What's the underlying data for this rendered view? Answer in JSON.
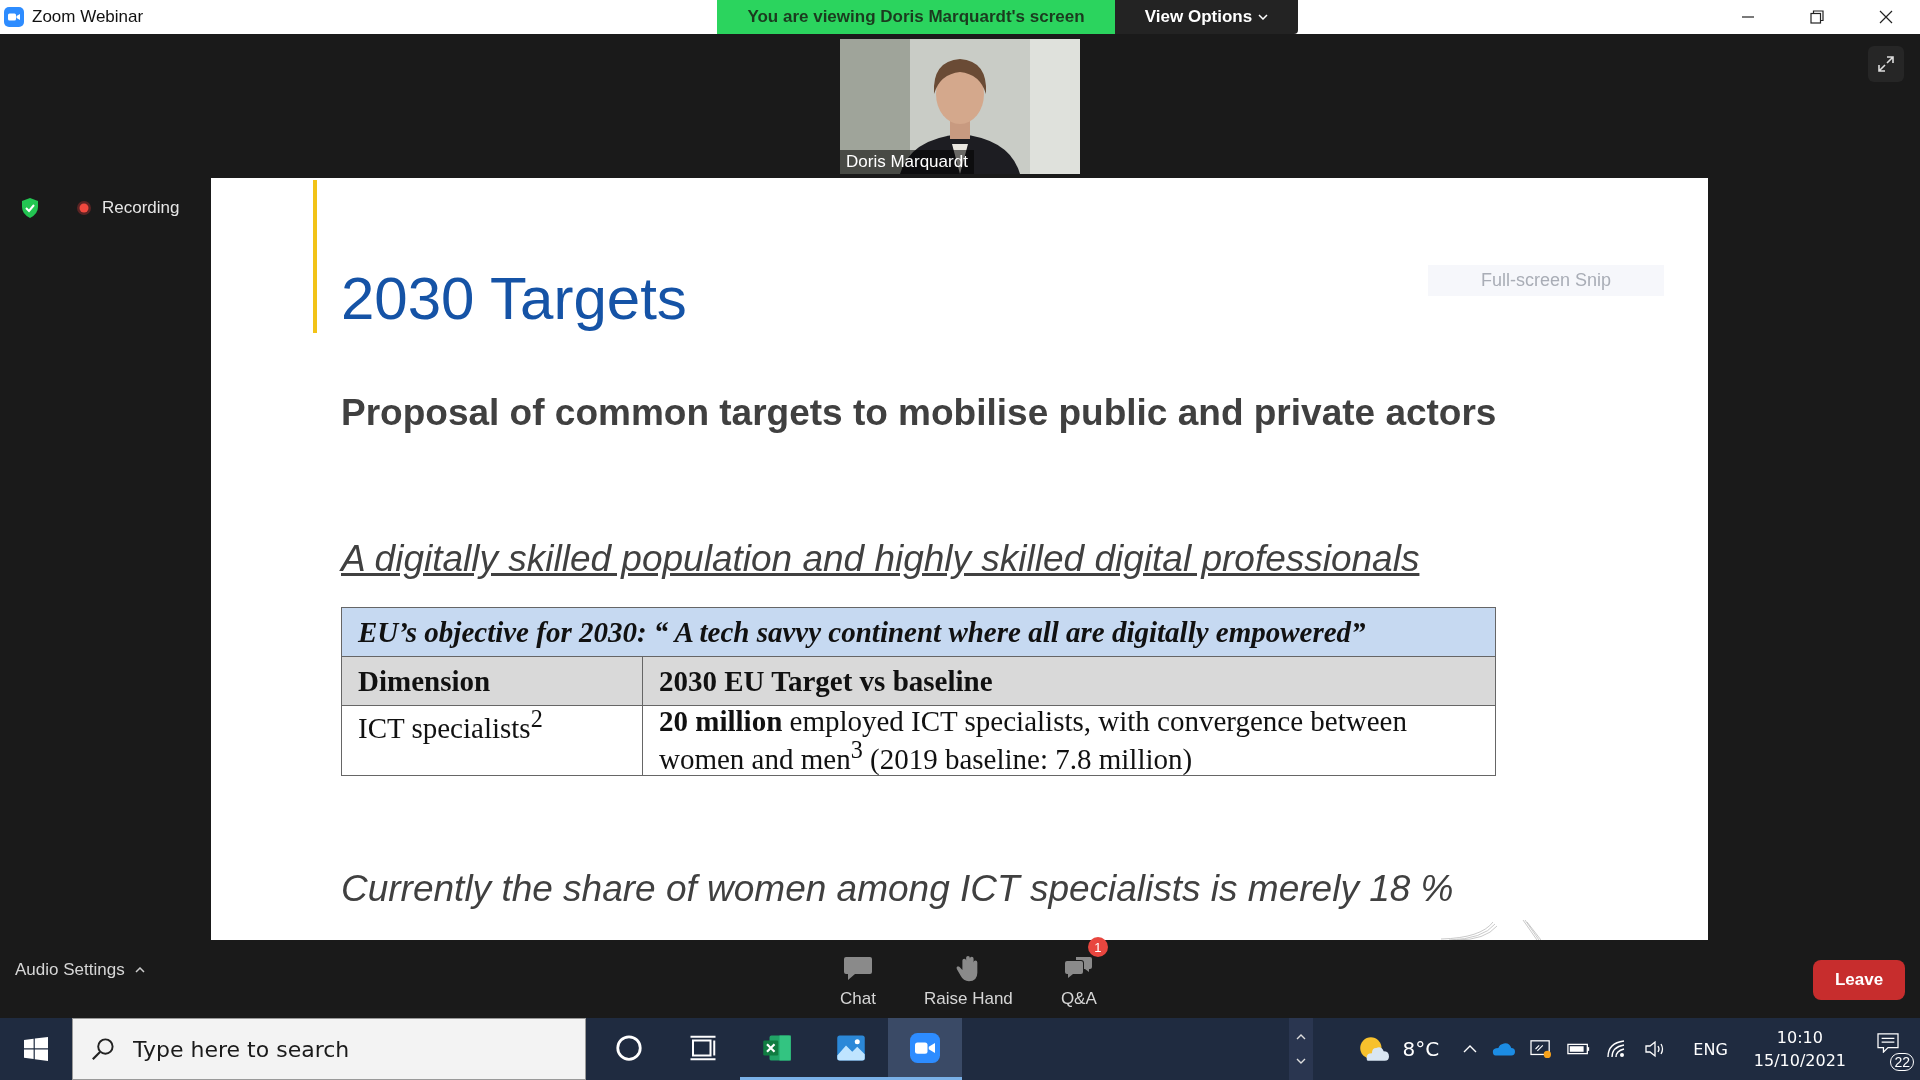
{
  "window": {
    "title": "Zoom Webinar"
  },
  "share_banner": {
    "text": "You are viewing Doris Marquardt's screen",
    "view_options": "View Options"
  },
  "video": {
    "name": "Doris Marquardt"
  },
  "recording": {
    "label": "Recording"
  },
  "slide": {
    "title": "2030 Targets",
    "subtitle": "Proposal of common targets to mobilise public and private actors",
    "section_heading": "A digitally skilled population and highly skilled digital professionals",
    "table": {
      "caption": "EU’s objective for 2030: “ A tech savvy continent where all are digitally empowered”",
      "columns": [
        "Dimension",
        "2030 EU Target vs baseline"
      ],
      "rows": [
        [
          "ICT specialists$^{2}$",
          "**20 million** employed ICT specialists, with convergence between women and men$^{3}$ (2019 baseline: 7.8 million)"
        ]
      ]
    },
    "footer": "Currently the share of women among ICT specialists is merely 18 %"
  },
  "snip_tooltip": "Full-screen Snip",
  "audio_settings": "Audio Settings",
  "toolbar": [
    {
      "kind": "chat",
      "label": "Chat"
    },
    {
      "kind": "hand",
      "label": "Raise Hand"
    },
    {
      "kind": "qa",
      "label": "Q&A",
      "badge": "1"
    }
  ],
  "leave": "Leave",
  "taskbar": {
    "search": {
      "placeholder": "Type here to search"
    },
    "apps": [
      {
        "kind": "cortana",
        "running": false,
        "selected": false
      },
      {
        "kind": "taskview",
        "running": false,
        "selected": false
      },
      {
        "kind": "excel",
        "running": true,
        "selected": false
      },
      {
        "kind": "photos",
        "running": true,
        "selected": false
      },
      {
        "kind": "zoom",
        "running": true,
        "selected": true
      }
    ]
  },
  "tray": {
    "temperature": "8°C",
    "language": "ENG",
    "time": "10:10",
    "date": "15/10/2021",
    "notifications": "22"
  }
}
